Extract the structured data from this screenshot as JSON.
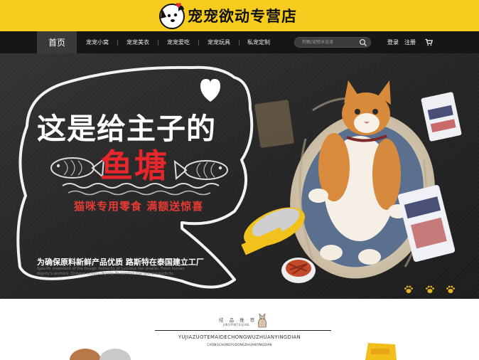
{
  "header": {
    "shop_name": "宠宠欲动专营店",
    "logo_icon": "dog-mascot-icon",
    "brand_color": "#f6cd1f"
  },
  "nav": {
    "home": "首页",
    "items": [
      "宠宠小窝",
      "宠宠美衣",
      "宠宠爱吃",
      "宠宠玩具",
      "私宠定制"
    ],
    "search_placeholder": "狗粮/宠物沐浴液",
    "login": "登录",
    "register": "注册",
    "cart_icon": "cart-icon"
  },
  "banner": {
    "headline": "这是给主子的",
    "highlight": "鱼塘",
    "highlight_color": "#e5262c",
    "subline": "猫咪专用零食 满额送惊喜",
    "tagline": "为确保原料新鲜产品优质 路斯特在泰国建立工厂",
    "fine_print": "Specific treatment of the Design Authority of Luscious too smaller. Fresh human dignity's anchors. Chinese sinful's dignity. To comfort the lipid products to."
  },
  "section": {
    "title": "结 品 推 荐",
    "title_en": "JINGPINTUIJIAN",
    "line1": "YUJIAZUOTEMAIDECHONGWUZHUANYINGDIAN",
    "line2": "CHONGCHONGYUDONGZHUANYINGDIAN"
  }
}
